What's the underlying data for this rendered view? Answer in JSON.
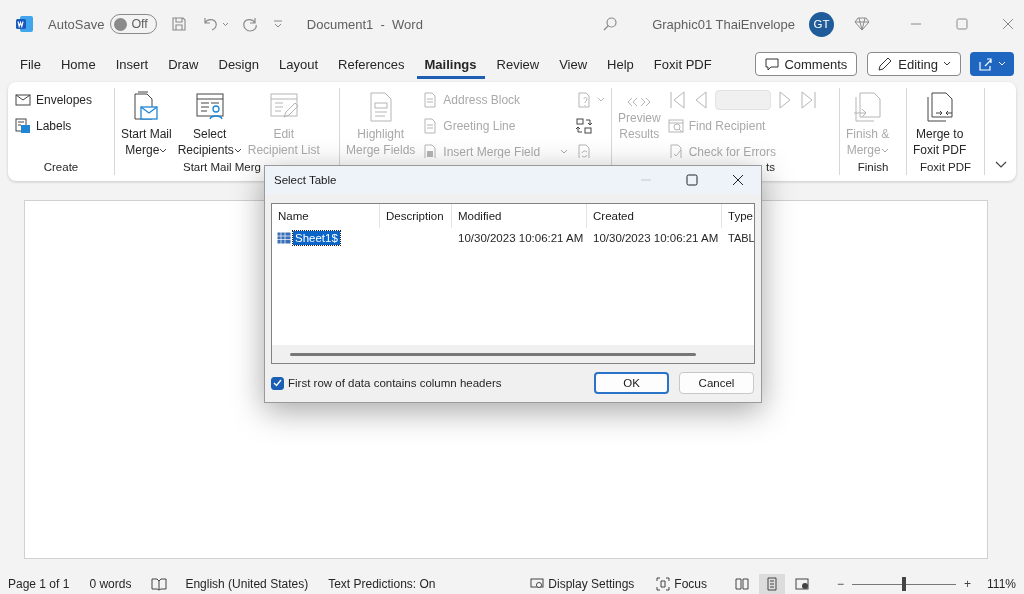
{
  "title_bar": {
    "autosave_label": "AutoSave",
    "autosave": {
      "on": false,
      "label": "Off"
    },
    "document_title": "Document1  -  Word",
    "account_name": "Graphic01 ThaiEnvelope",
    "avatar_initials": "GT"
  },
  "tabs": [
    {
      "label": "File",
      "selected": false
    },
    {
      "label": "Home",
      "selected": false
    },
    {
      "label": "Insert",
      "selected": false
    },
    {
      "label": "Draw",
      "selected": false
    },
    {
      "label": "Design",
      "selected": false
    },
    {
      "label": "Layout",
      "selected": false
    },
    {
      "label": "References",
      "selected": false
    },
    {
      "label": "Mailings",
      "selected": true
    },
    {
      "label": "Review",
      "selected": false
    },
    {
      "label": "View",
      "selected": false
    },
    {
      "label": "Help",
      "selected": false
    },
    {
      "label": "Foxit PDF",
      "selected": false
    }
  ],
  "tab_actions": {
    "comments": "Comments",
    "editing": "Editing"
  },
  "ribbon": {
    "groups": [
      {
        "label": "Create",
        "columns": [
          [
            {
              "kind": "small",
              "label": "Envelopes",
              "disabled": false
            },
            {
              "kind": "small",
              "label": "Labels",
              "disabled": false
            }
          ]
        ]
      },
      {
        "label": "Start Mail Merg",
        "columns": [
          [
            {
              "kind": "large",
              "label": "Start Mail\nMerge",
              "dropdown": true,
              "disabled": false
            }
          ],
          [
            {
              "kind": "large",
              "label": "Select\nRecipients",
              "dropdown": true,
              "disabled": false
            }
          ],
          [
            {
              "kind": "large",
              "label": "Edit\nRecipient List",
              "dropdown": false,
              "disabled": true
            }
          ]
        ]
      },
      {
        "columns": [
          [
            {
              "kind": "large",
              "label": "Highlight\nMerge Fields",
              "dropdown": false,
              "disabled": true
            }
          ],
          [
            {
              "kind": "small",
              "label": "Address Block",
              "disabled": true
            },
            {
              "kind": "small",
              "label": "Greeting Line",
              "disabled": true
            },
            {
              "kind": "small",
              "label": "Insert Merge Field",
              "dropdown": true,
              "disabled": true
            }
          ],
          [
            {
              "kind": "icon",
              "dropdown": true,
              "disabled": true
            },
            {
              "kind": "icon",
              "dropdown": false,
              "disabled": false
            },
            {
              "kind": "icon",
              "dropdown": false,
              "disabled": true
            }
          ]
        ]
      },
      {
        "label": "ts",
        "columns": [
          [
            {
              "kind": "large",
              "label": "Preview\nResults",
              "dropdown": false,
              "disabled": true
            }
          ],
          [
            {
              "kind": "nav",
              "disabled": true
            },
            {
              "kind": "small",
              "label": "Find Recipient",
              "disabled": true
            },
            {
              "kind": "small",
              "label": "Check for Errors",
              "disabled": true
            }
          ]
        ]
      },
      {
        "label": "Finish",
        "columns": [
          [
            {
              "kind": "large",
              "label": "Finish &\nMerge",
              "dropdown": true,
              "disabled": true
            }
          ]
        ]
      },
      {
        "label": "Foxit PDF",
        "columns": [
          [
            {
              "kind": "large",
              "label": "Merge to\nFoxit PDF",
              "dropdown": false,
              "disabled": false
            }
          ]
        ]
      }
    ]
  },
  "dialog": {
    "title": "Select Table",
    "columns": [
      "Name",
      "Description",
      "Modified",
      "Created",
      "Type"
    ],
    "rows": [
      {
        "name": "Sheet1$",
        "modified": "10/30/2023 10:06:21 AM",
        "created": "10/30/2023 10:06:21 AM",
        "type": "TABL",
        "selected": true
      }
    ],
    "header_option": {
      "label": "First row of data contains column headers",
      "checked": true
    },
    "buttons": [
      {
        "label": "OK",
        "default": true
      },
      {
        "label": "Cancel",
        "default": false
      }
    ]
  },
  "status_bar": {
    "page": "Page 1 of 1",
    "words": "0 words",
    "language": "English (United States)",
    "predictions": "Text Predictions: On",
    "display_settings": "Display Settings",
    "focus": "Focus",
    "views": [
      {
        "selected": false
      },
      {
        "selected": true
      },
      {
        "selected": false
      }
    ],
    "zoom": {
      "minus": "−",
      "plus": "+",
      "level": 0.5,
      "percent": "111%"
    }
  }
}
